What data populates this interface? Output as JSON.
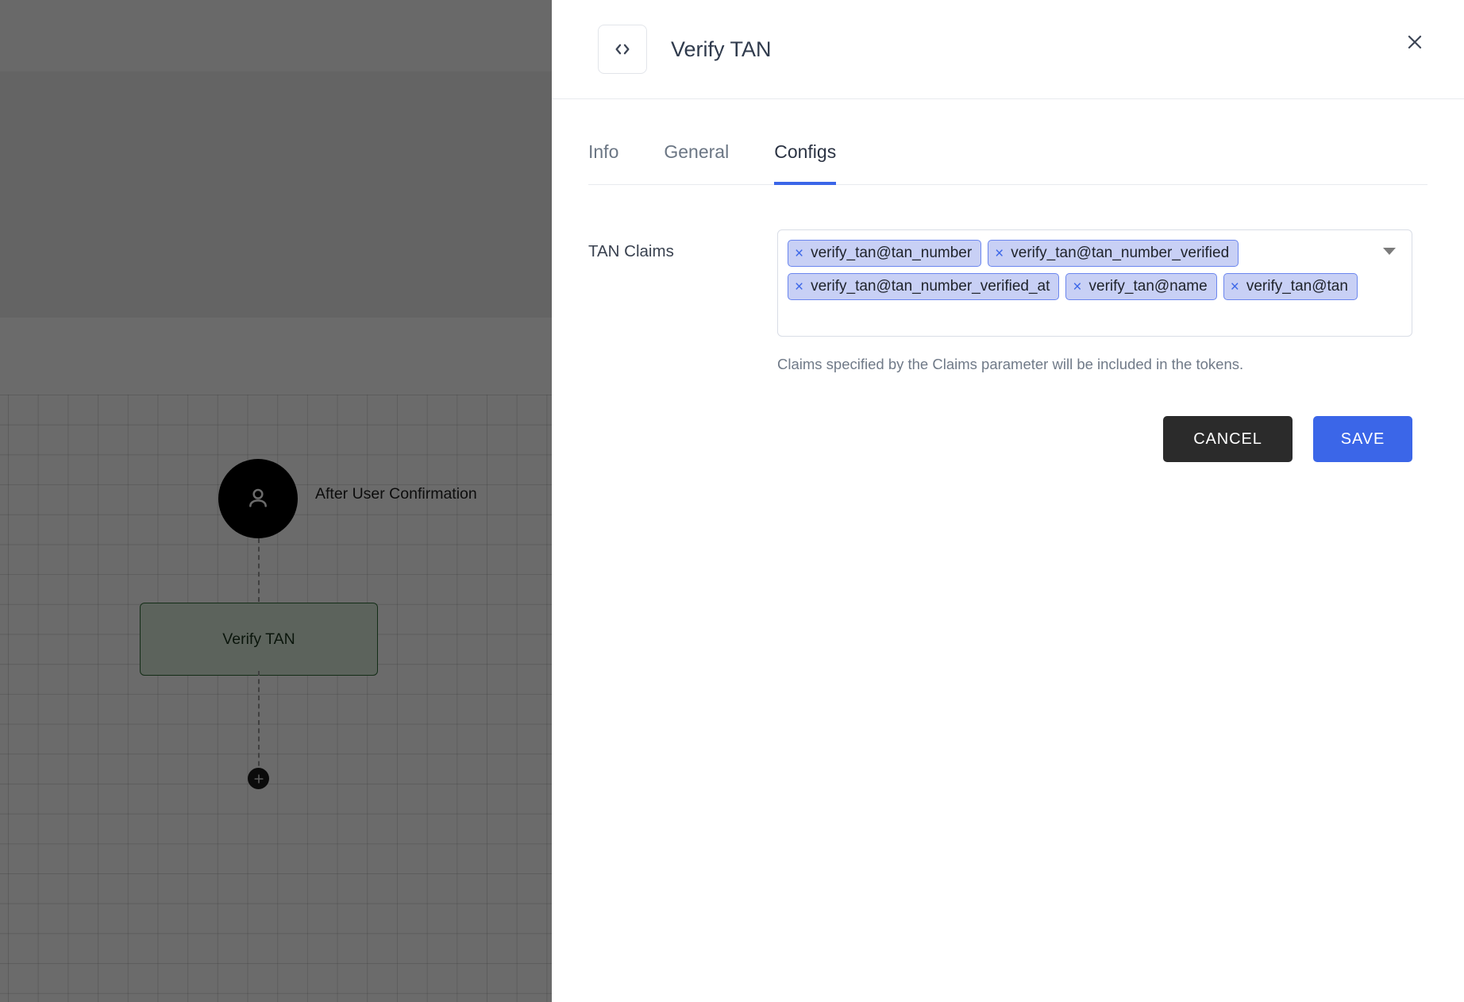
{
  "canvas": {
    "trigger": {
      "label": "After User Confirmation",
      "icon": "user-icon"
    },
    "node": {
      "label": "Verify TAN"
    },
    "add_button": {
      "icon": "plus-icon"
    }
  },
  "panel": {
    "icon": "code-brackets-icon",
    "title": "Verify TAN",
    "close_icon": "close-icon",
    "tabs": [
      {
        "label": "Info",
        "active": false
      },
      {
        "label": "General",
        "active": false
      },
      {
        "label": "Configs",
        "active": true
      }
    ],
    "field": {
      "label": "TAN Claims",
      "chips": [
        "verify_tan@tan_number",
        "verify_tan@tan_number_verified",
        "verify_tan@tan_number_verified_at",
        "verify_tan@name",
        "verify_tan@tan"
      ],
      "chip_remove_glyph": "×",
      "dropdown_icon": "chevron-down-icon",
      "helper_text": "Claims specified by the Claims parameter will be included in the tokens."
    },
    "actions": {
      "cancel_label": "CANCEL",
      "save_label": "SAVE"
    }
  },
  "colors": {
    "accent": "#3b66e8",
    "chip_bg": "#c8d0f5",
    "chip_border": "#6b86ee",
    "cancel_bg": "#2b2b2b",
    "node_border": "#2e6b36"
  }
}
